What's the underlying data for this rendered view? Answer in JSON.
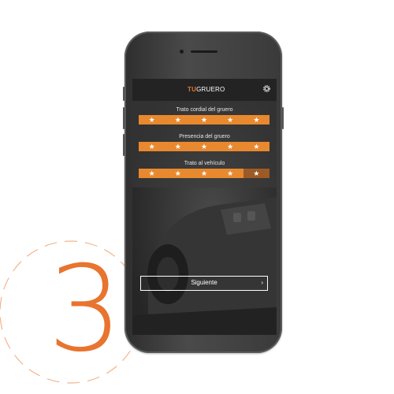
{
  "step": {
    "number": "3",
    "accent_color": "#e8742f"
  },
  "app": {
    "brand_part1": "TU",
    "brand_part2": "GRUERO",
    "settings_icon": "gear-icon"
  },
  "ratings": [
    {
      "label": "Trato cordial del gruero",
      "stars_total": 5,
      "stars_selected": 5
    },
    {
      "label": "Presencia del gruero",
      "stars_total": 5,
      "stars_selected": 5
    },
    {
      "label": "Trato al vehículo",
      "stars_total": 5,
      "stars_selected": 4
    }
  ],
  "next_button": {
    "label": "Siguiente",
    "icon": "chevron-right-icon",
    "chevron": "›"
  },
  "colors": {
    "star_active": "#e8892f",
    "star_inactive": "#9c5a26",
    "screen_bg": "#2d2d2d"
  }
}
